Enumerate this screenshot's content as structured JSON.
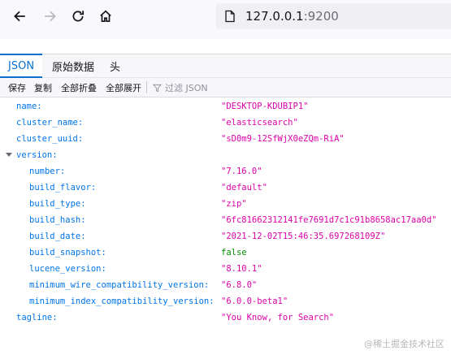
{
  "browser": {
    "url_host": "127.0.0.1",
    "url_port": ":9200"
  },
  "viewer_tabs": [
    {
      "label": "JSON",
      "active": true
    },
    {
      "label": "原始数据",
      "active": false
    },
    {
      "label": "头",
      "active": false
    }
  ],
  "toolbar": {
    "save": "保存",
    "copy": "复制",
    "collapse_all": "全部折叠",
    "expand_all": "全部展开",
    "filter_placeholder": "过滤 JSON"
  },
  "json": {
    "name": {
      "key": "name:",
      "value": "\"DESKTOP-KDUBIP1\""
    },
    "cluster_name": {
      "key": "cluster_name:",
      "value": "\"elasticsearch\""
    },
    "cluster_uuid": {
      "key": "cluster_uuid:",
      "value": "\"sD0m9-12SfWjX0eZQm-RiA\""
    },
    "version": {
      "key": "version:"
    },
    "number": {
      "key": "number:",
      "value": "\"7.16.0\""
    },
    "build_flavor": {
      "key": "build_flavor:",
      "value": "\"default\""
    },
    "build_type": {
      "key": "build_type:",
      "value": "\"zip\""
    },
    "build_hash": {
      "key": "build_hash:",
      "value": "\"6fc81662312141fe7691d7c1c91b8658ac17aa0d\""
    },
    "build_date": {
      "key": "build_date:",
      "value": "\"2021-12-02T15:46:35.697268109Z\""
    },
    "build_snapshot": {
      "key": "build_snapshot:",
      "value": "false"
    },
    "lucene_version": {
      "key": "lucene_version:",
      "value": "\"8.10.1\""
    },
    "minimum_wire_compatibility_version": {
      "key": "minimum_wire_compatibility_version:",
      "value": "\"6.8.0\""
    },
    "minimum_index_compatibility_version": {
      "key": "minimum_index_compatibility_version:",
      "value": "\"6.0.0-beta1\""
    },
    "tagline": {
      "key": "tagline:",
      "value": "\"You Know, for Search\""
    }
  },
  "watermark": "@稀土掘金技术社区",
  "colors": {
    "key": "#0074e8",
    "string": "#dd00a9",
    "boolean": "#058b00",
    "accent": "#0b6fcf"
  }
}
